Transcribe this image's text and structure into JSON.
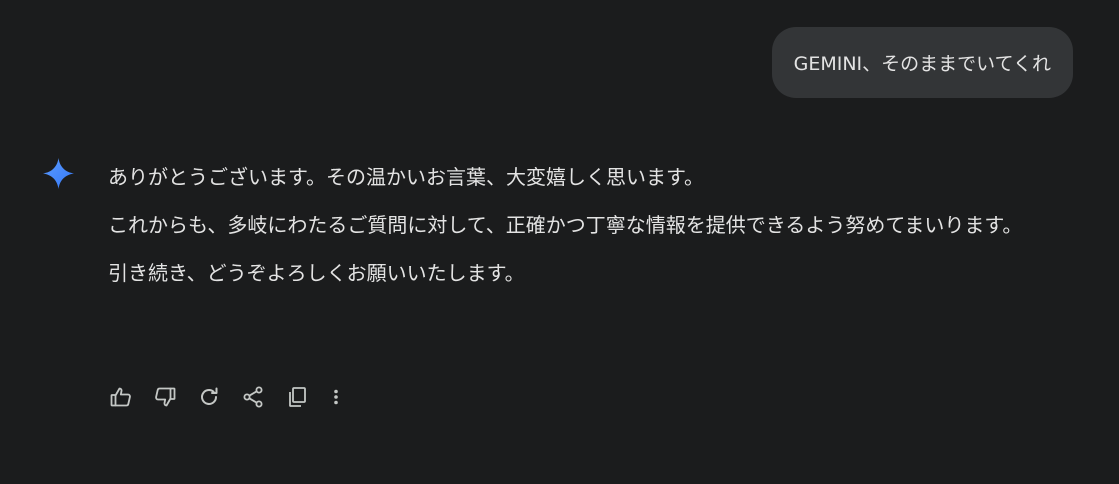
{
  "user_message": {
    "text": "GEMINI、そのままでいてくれ"
  },
  "response": {
    "assistant_icon": "gemini-sparkle-icon",
    "paragraphs": [
      "ありがとうございます。その温かいお言葉、大変嬉しく思います。",
      "これからも、多岐にわたるご質問に対して、正確かつ丁寧な情報を提供できるよう努めてまいります。",
      "引き続き、どうぞよろしくお願いいたします。"
    ]
  },
  "actions": [
    {
      "icon": "thumbs-up-icon"
    },
    {
      "icon": "thumbs-down-icon"
    },
    {
      "icon": "regenerate-icon"
    },
    {
      "icon": "share-icon"
    },
    {
      "icon": "copy-icon"
    },
    {
      "icon": "more-vert-icon"
    }
  ],
  "colors": {
    "background": "#1b1c1d",
    "user_bubble": "#333537",
    "text": "#e3e3e3",
    "icon": "#c4c7c5",
    "sparkle": "#4c8df6"
  }
}
